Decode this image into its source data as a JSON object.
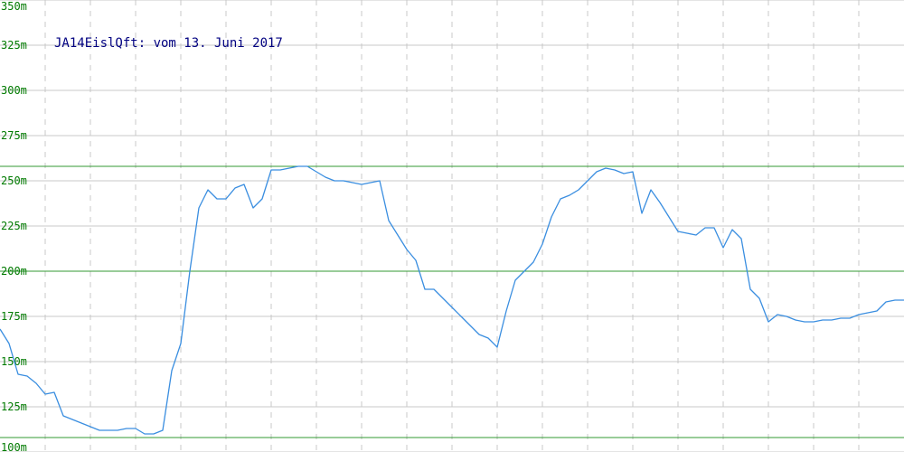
{
  "chart_data": {
    "type": "line",
    "title": "JA14EislQft: vom 13. Juni 2017",
    "xlabel": "",
    "ylabel": "",
    "ylim": [
      100,
      350
    ],
    "y_ticks": [
      {
        "value": 350,
        "label": "350m"
      },
      {
        "value": 325,
        "label": "325m"
      },
      {
        "value": 300,
        "label": "300m"
      },
      {
        "value": 275,
        "label": "275m"
      },
      {
        "value": 250,
        "label": "250m"
      },
      {
        "value": 225,
        "label": "225m"
      },
      {
        "value": 200,
        "label": "200m"
      },
      {
        "value": 175,
        "label": "175m"
      },
      {
        "value": 150,
        "label": "150m"
      },
      {
        "value": 125,
        "label": "125m"
      },
      {
        "value": 100,
        "label": "100m"
      }
    ],
    "reference_lines": [
      258,
      200,
      108
    ],
    "grid": true,
    "colors": {
      "line": "#3a8ee0",
      "reference": "#339933",
      "grid_h": "#c8c8c8",
      "grid_v": "#c8c8c8",
      "title": "#000080",
      "tick": "#007a00"
    },
    "series": [
      {
        "x": [
          0,
          1,
          2,
          3,
          4,
          5,
          6,
          7,
          8,
          9,
          10,
          11,
          12,
          13,
          14,
          15,
          16,
          17,
          18,
          19,
          20,
          21,
          22,
          23,
          24,
          25,
          26,
          27,
          28,
          29,
          30,
          31,
          32,
          33,
          34,
          35,
          36,
          37,
          38,
          39,
          40,
          41,
          42,
          43,
          44,
          45,
          46,
          47,
          48,
          49,
          50,
          51,
          52,
          53,
          54,
          55,
          56,
          57,
          58,
          59,
          60,
          61,
          62,
          63,
          64,
          65,
          66,
          67,
          68,
          69,
          70,
          71,
          72,
          73,
          74,
          75,
          76,
          77,
          78,
          79,
          80,
          81,
          82,
          83,
          84,
          85,
          86,
          87,
          88,
          89,
          90,
          91,
          92,
          93,
          94,
          95,
          96,
          97,
          98,
          99,
          100
        ],
        "y": [
          168,
          160,
          143,
          142,
          138,
          132,
          133,
          120,
          118,
          116,
          114,
          112,
          112,
          112,
          113,
          113,
          110,
          110,
          112,
          145,
          160,
          200,
          235,
          245,
          240,
          240,
          246,
          248,
          235,
          240,
          256,
          256,
          257,
          258,
          258,
          255,
          252,
          250,
          250,
          249,
          248,
          249,
          250,
          228,
          220,
          212,
          206,
          190,
          190,
          185,
          180,
          175,
          170,
          165,
          163,
          158,
          178,
          195,
          200,
          205,
          215,
          230,
          240,
          242,
          245,
          250,
          255,
          257,
          256,
          254,
          255,
          232,
          245,
          238,
          230,
          222,
          221,
          220,
          224,
          224,
          213,
          223,
          218,
          190,
          185,
          172,
          176,
          175,
          173,
          172,
          172,
          173,
          173,
          174,
          174,
          176,
          177,
          178,
          183,
          184,
          184
        ]
      }
    ]
  }
}
